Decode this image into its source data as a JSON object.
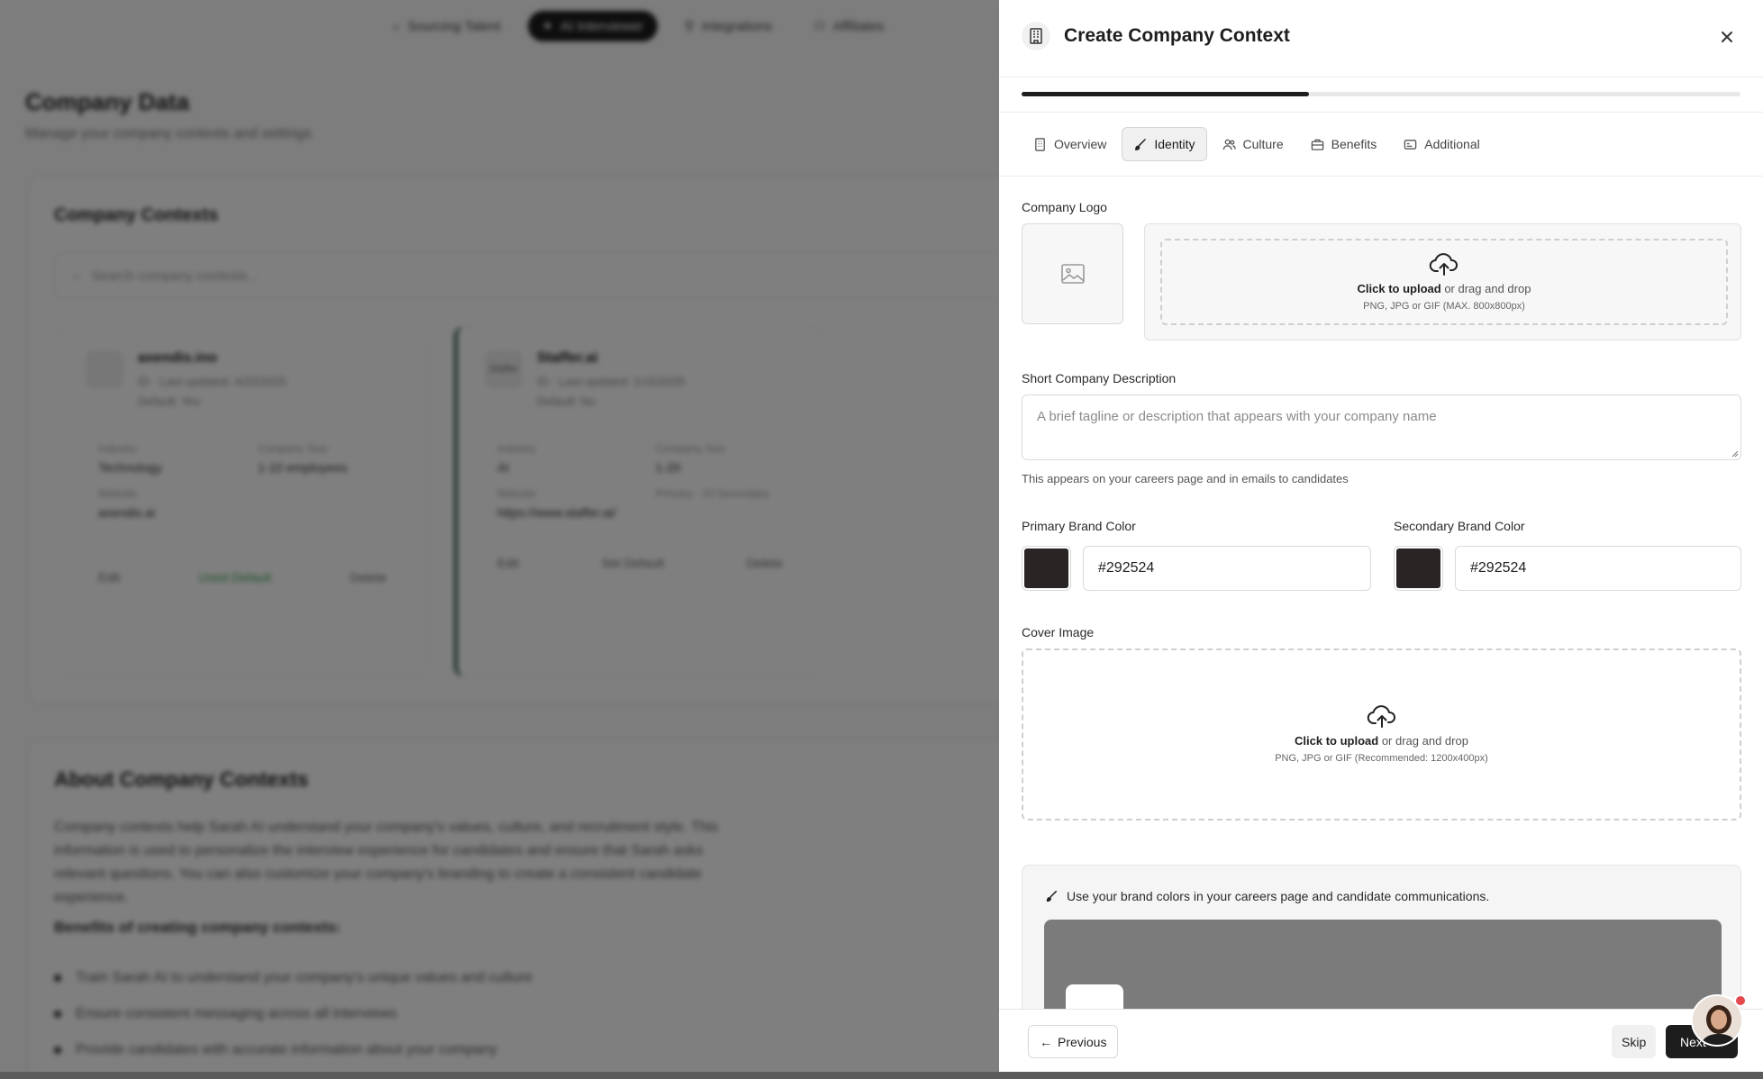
{
  "background": {
    "nav": [
      {
        "label": "Sourcing Talent",
        "icon": "search-icon",
        "active": false
      },
      {
        "label": "AI Interviewer",
        "icon": "sparkle-icon",
        "active": true
      },
      {
        "label": "Integrations",
        "icon": "plug-icon",
        "active": false
      },
      {
        "label": "Affiliates",
        "icon": "users-icon",
        "active": false
      }
    ],
    "title": "Company Data",
    "subtitle": "Manage your company contexts and settings",
    "section_title": "Company Contexts",
    "search_placeholder": "Search company contexts...",
    "cards": [
      {
        "logo": "",
        "name": "axendis.ino",
        "updated": "ID · Last updated: 4/22/2025",
        "default": "Default: Yes",
        "industry_label": "Industry",
        "industry": "Technology",
        "size_label": "Company Size",
        "size": "1-10 employees",
        "website_label": "Website",
        "website": "axendis.ai",
        "extra": "",
        "actions": [
          "Edit",
          "Used Default",
          "Delete"
        ]
      },
      {
        "logo": "Staffer",
        "name": "Staffer.ai",
        "updated": "ID · Last updated: 1/15/2025",
        "default": "Default: No",
        "industry_label": "Industry",
        "industry": "AI",
        "size_label": "Company Size",
        "size": "1-20",
        "website_label": "Website",
        "website": "https://www.staffer.ai/",
        "extra": "Primary · 10 Secondary",
        "actions": [
          "Edit",
          "Set Default",
          "Delete"
        ]
      }
    ],
    "about_title": "About Company Contexts",
    "about_text": "Company contexts help Sarah AI understand your company's values, culture, and recruitment style. This information is used to personalize the interview experience for candidates and ensure that Sarah asks relevant questions. You can also customize your company's branding to create a consistent candidate experience.",
    "benefits_title": "Benefits of creating company contexts:",
    "benefits": [
      "Train Sarah AI to understand your company's unique values and culture",
      "Ensure consistent messaging across all interviews",
      "Provide candidates with accurate information about your company"
    ]
  },
  "drawer": {
    "title": "Create Company Context",
    "header_icon": "building-icon",
    "progress": 0.4,
    "tabs": [
      {
        "label": "Overview",
        "icon": "building-icon",
        "active": false
      },
      {
        "label": "Identity",
        "icon": "brush-icon",
        "active": true
      },
      {
        "label": "Culture",
        "icon": "users-icon",
        "active": false
      },
      {
        "label": "Benefits",
        "icon": "briefcase-icon",
        "active": false
      },
      {
        "label": "Additional",
        "icon": "card-icon",
        "active": false
      }
    ],
    "logo_label": "Company Logo",
    "upload_click": "Click to upload",
    "upload_rest": " or drag and drop",
    "logo_hint": "PNG, JPG or GIF (MAX. 800x800px)",
    "desc_label": "Short Company Description",
    "desc_placeholder": "A brief tagline or description that appears with your company name",
    "desc_help": "This appears on your careers page and in emails to candidates",
    "primary_label": "Primary Brand Color",
    "primary_value": "#292524",
    "secondary_label": "Secondary Brand Color",
    "secondary_value": "#292524",
    "cover_label": "Cover Image",
    "cover_hint": "PNG, JPG or GIF (Recommended: 1200x400px)",
    "preview_caption": "Use your brand colors in your careers page and candidate communications.",
    "footer": {
      "previous": "Previous",
      "skip": "Skip",
      "next": "Next"
    }
  },
  "colors": {
    "accent": "#1d1d1d",
    "primary_brand": "#292524",
    "secondary_brand": "#292524",
    "notification": "#e5484d"
  }
}
